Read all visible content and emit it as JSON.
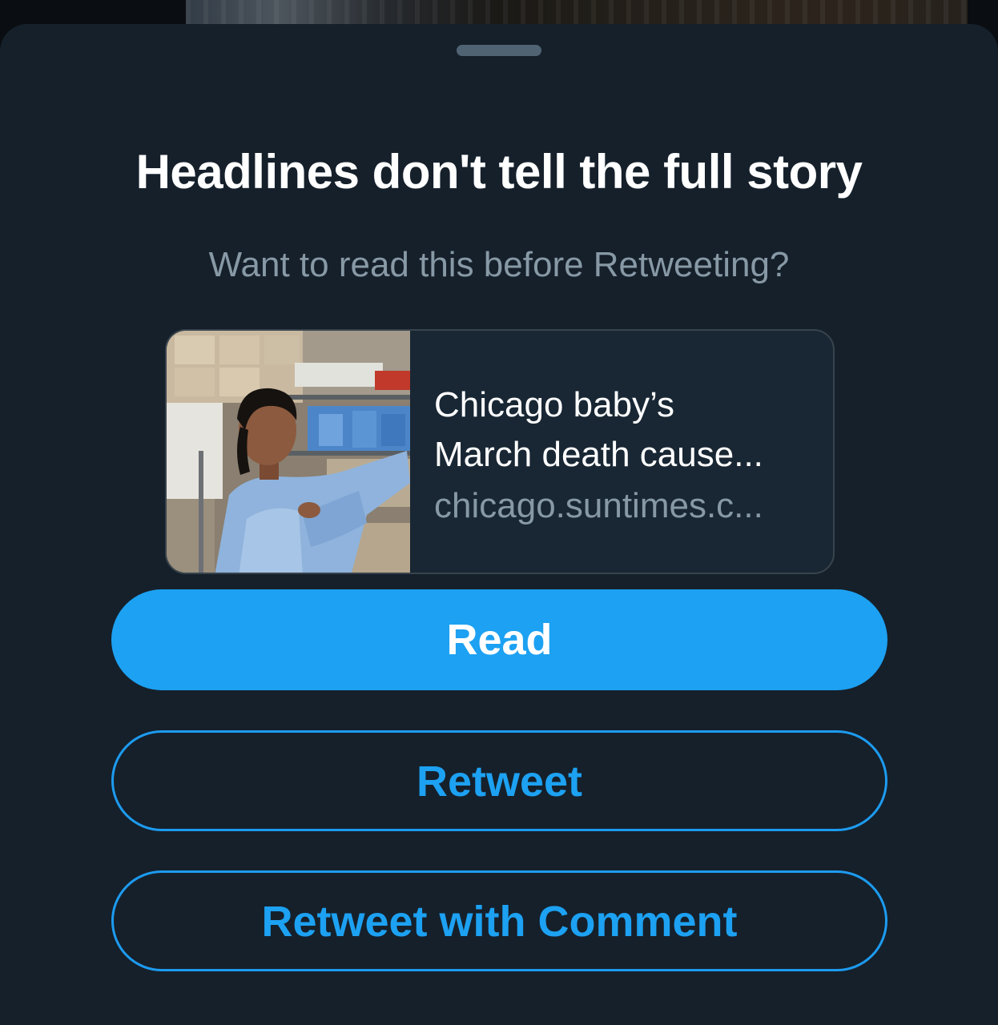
{
  "sheet": {
    "title": "Headlines don't tell the full story",
    "subtitle": "Want to read this before Retweeting?"
  },
  "link_card": {
    "title_line1": "Chicago baby’s",
    "title_line2": "March death cause...",
    "domain": "chicago.suntimes.c...",
    "image": "photo of a health worker putting on a blue protective gown in a supply room"
  },
  "actions": {
    "read_label": "Read",
    "retweet_label": "Retweet",
    "retweet_comment_label": "Retweet with Comment"
  },
  "colors": {
    "background": "#15202b",
    "accent": "#1da1f2",
    "text_primary": "#ffffff",
    "text_secondary": "#8899a6",
    "card_border": "#38444d"
  }
}
